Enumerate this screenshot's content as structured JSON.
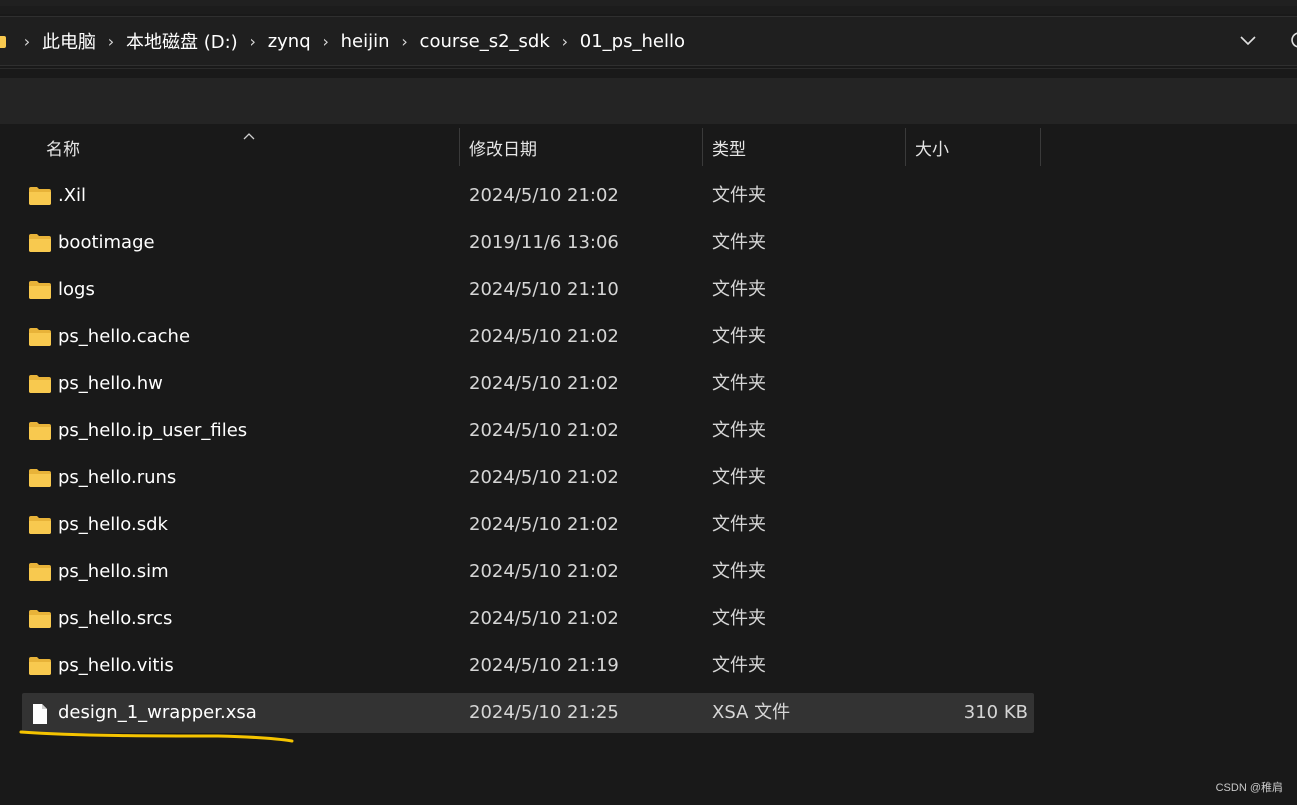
{
  "address_bar": {
    "breadcrumbs": [
      "此电脑",
      "本地磁盘 (D:)",
      "zynq",
      "heijin",
      "course_s2_sdk",
      "01_ps_hello"
    ]
  },
  "columns": {
    "name": "名称",
    "modified": "修改日期",
    "type": "类型",
    "size": "大小"
  },
  "files": [
    {
      "name": ".Xil",
      "modified": "2024/5/10 21:02",
      "type": "文件夹",
      "size": "",
      "icon": "folder-icon"
    },
    {
      "name": "bootimage",
      "modified": "2019/11/6 13:06",
      "type": "文件夹",
      "size": "",
      "icon": "folder-icon"
    },
    {
      "name": "logs",
      "modified": "2024/5/10 21:10",
      "type": "文件夹",
      "size": "",
      "icon": "folder-icon"
    },
    {
      "name": "ps_hello.cache",
      "modified": "2024/5/10 21:02",
      "type": "文件夹",
      "size": "",
      "icon": "folder-icon"
    },
    {
      "name": "ps_hello.hw",
      "modified": "2024/5/10 21:02",
      "type": "文件夹",
      "size": "",
      "icon": "folder-icon"
    },
    {
      "name": "ps_hello.ip_user_files",
      "modified": "2024/5/10 21:02",
      "type": "文件夹",
      "size": "",
      "icon": "folder-icon"
    },
    {
      "name": "ps_hello.runs",
      "modified": "2024/5/10 21:02",
      "type": "文件夹",
      "size": "",
      "icon": "folder-icon"
    },
    {
      "name": "ps_hello.sdk",
      "modified": "2024/5/10 21:02",
      "type": "文件夹",
      "size": "",
      "icon": "folder-icon"
    },
    {
      "name": "ps_hello.sim",
      "modified": "2024/5/10 21:02",
      "type": "文件夹",
      "size": "",
      "icon": "folder-icon"
    },
    {
      "name": "ps_hello.srcs",
      "modified": "2024/5/10 21:02",
      "type": "文件夹",
      "size": "",
      "icon": "folder-icon"
    },
    {
      "name": "ps_hello.vitis",
      "modified": "2024/5/10 21:19",
      "type": "文件夹",
      "size": "",
      "icon": "folder-icon"
    },
    {
      "name": "design_1_wrapper.xsa",
      "modified": "2024/5/10 21:25",
      "type": "XSA 文件",
      "size": "310 KB",
      "icon": "file-icon",
      "selected": true
    }
  ],
  "watermark": "CSDN @稚肩",
  "colors": {
    "background": "#191919",
    "folder": "#f8c94f",
    "selected_row": "#333333",
    "annotation_underline": "#f5c400"
  }
}
